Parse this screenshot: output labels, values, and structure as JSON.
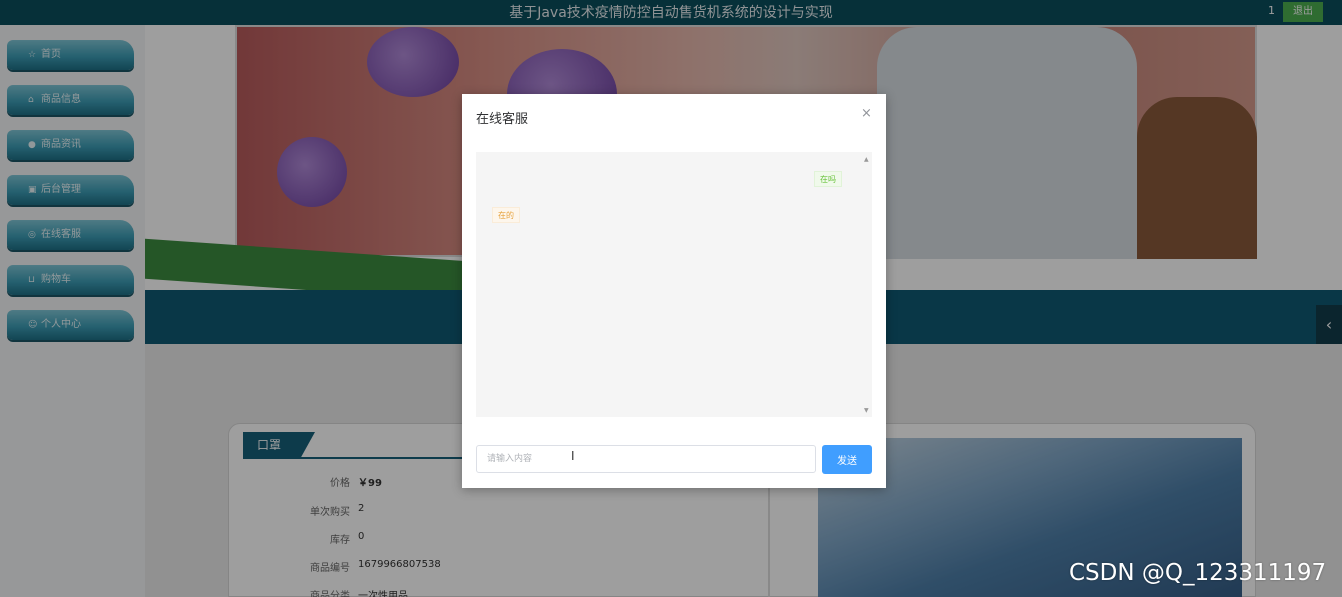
{
  "header": {
    "title": "基于Java技术疫情防控自动售货机系统的设计与实现",
    "user": "1",
    "logout_label": "退出"
  },
  "sidebar": {
    "items": [
      {
        "label": "首页",
        "icon": "star-icon",
        "glyph": "☆"
      },
      {
        "label": "商品信息",
        "icon": "home-icon",
        "glyph": "⌂"
      },
      {
        "label": "商品资讯",
        "icon": "info-icon",
        "glyph": "●"
      },
      {
        "label": "后台管理",
        "icon": "monitor-icon",
        "glyph": "▣"
      },
      {
        "label": "在线客服",
        "icon": "headset-icon",
        "glyph": "◎"
      },
      {
        "label": "购物车",
        "icon": "cart-icon",
        "glyph": "⊔"
      },
      {
        "label": "个人中心",
        "icon": "user-icon",
        "glyph": "☺"
      }
    ]
  },
  "product": {
    "title": "口罩",
    "fields": [
      {
        "key": "价格",
        "value": "￥99"
      },
      {
        "key": "单次购买",
        "value": "2"
      },
      {
        "key": "库存",
        "value": "0"
      },
      {
        "key": "商品编号",
        "value": "1679966807538"
      },
      {
        "key": "商品分类",
        "value": "一次性用品"
      }
    ]
  },
  "dialog": {
    "title": "在线客服",
    "close_glyph": "×",
    "messages": [
      {
        "side": "right",
        "text": "在吗"
      },
      {
        "side": "left",
        "text": "在的"
      }
    ],
    "input_placeholder": "请输入内容",
    "send_label": "发送"
  },
  "watermark": "CSDN @Q_123311197",
  "colors": {
    "topbar": "#0b4e5c",
    "accent_blue": "#409eff",
    "logout_green": "#4caf50",
    "brand_teal": "#15607a"
  }
}
